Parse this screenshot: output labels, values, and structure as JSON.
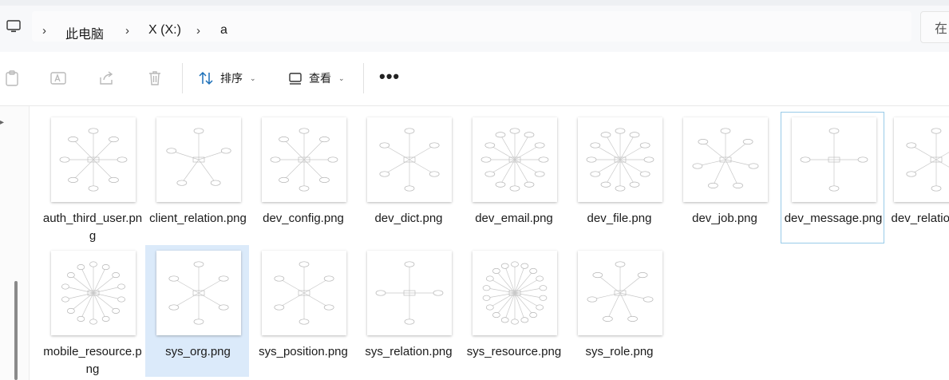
{
  "nav": {
    "computer_icon": "computer-icon",
    "breadcrumb": [
      "此电脑",
      "X (X:)",
      "a"
    ],
    "search_placeholder": "在"
  },
  "toolbar": {
    "icons": [
      "paste-icon",
      "rename-icon",
      "share-icon",
      "delete-icon"
    ],
    "sort_label": "排序",
    "view_label": "查看",
    "more_label": "•••"
  },
  "files": [
    {
      "name": "auth_third_user.png",
      "label": "auth_third_user.png",
      "state": "normal"
    },
    {
      "name": "client_relation.png",
      "label": "client_relation.png",
      "state": "normal"
    },
    {
      "name": "dev_config.png",
      "label": "dev_config.png",
      "state": "normal"
    },
    {
      "name": "dev_dict.png",
      "label": "dev_dict.png",
      "state": "normal"
    },
    {
      "name": "dev_email.png",
      "label": "dev_email.png",
      "state": "normal"
    },
    {
      "name": "dev_file.png",
      "label": "dev_file.png",
      "state": "normal"
    },
    {
      "name": "dev_job.png",
      "label": "dev_job.png",
      "state": "normal"
    },
    {
      "name": "dev_message.png",
      "label": "dev_message.png",
      "state": "hover"
    },
    {
      "name": "dev_relation.png",
      "label": "dev_relation.png",
      "state": "normal"
    },
    {
      "name": "mobile_resource.png",
      "label": "mobile_resource.png",
      "state": "normal"
    },
    {
      "name": "sys_org.png",
      "label": "sys_org.png",
      "state": "selected"
    },
    {
      "name": "sys_position.png",
      "label": "sys_position.png",
      "state": "normal"
    },
    {
      "name": "sys_relation.png",
      "label": "sys_relation.png",
      "state": "normal"
    },
    {
      "name": "sys_resource.png",
      "label": "sys_resource.png",
      "state": "normal"
    },
    {
      "name": "sys_role.png",
      "label": "sys_role.png",
      "state": "normal"
    }
  ],
  "colors": {
    "selected_bg": "#dbeafa",
    "hover_border": "#99cbe8",
    "text": "#1b1b1b"
  }
}
